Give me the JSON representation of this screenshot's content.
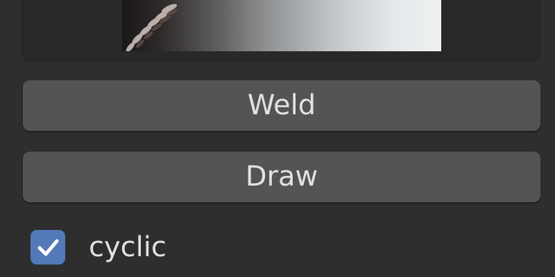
{
  "buttons": {
    "weld_label": "Weld",
    "draw_label": "Draw"
  },
  "cyclic": {
    "label": "cyclic",
    "checked": true
  },
  "colors": {
    "background": "#2e2e2e",
    "button": "#545454",
    "checkbox_accent": "#5379b8",
    "text": "#e2e2e2"
  },
  "icons": {
    "checkbox": "checkmark-icon"
  }
}
